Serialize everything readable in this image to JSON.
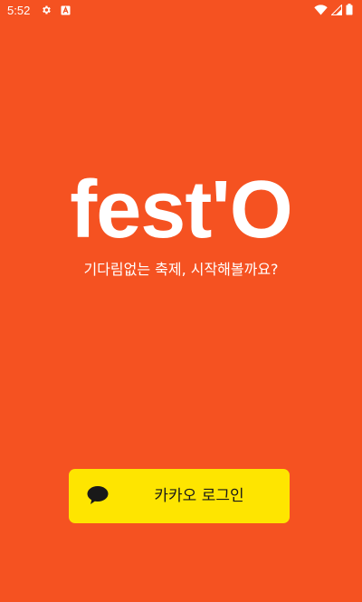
{
  "status_bar": {
    "time": "5:52",
    "left_icons": [
      "gear-icon",
      "font-a-icon"
    ],
    "right_icons": [
      "wifi-icon",
      "signal-icon",
      "battery-icon"
    ]
  },
  "splash": {
    "logo": "fest'O",
    "tagline": "기다림없는 축제, 시작해볼까요?"
  },
  "login": {
    "kakao_label": "카카오 로그인",
    "kakao_icon": "speech-bubble-icon"
  },
  "colors": {
    "background": "#F55221",
    "kakao_yellow": "#FEE500",
    "kakao_text": "#191919",
    "text_on_bg": "#FFFFFF"
  }
}
